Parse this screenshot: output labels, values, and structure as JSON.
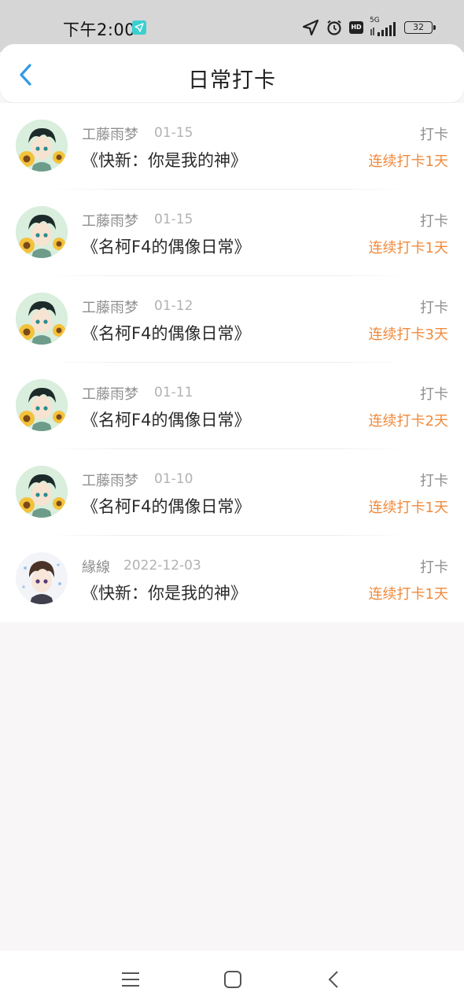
{
  "status_bar": {
    "time": "下午2:00",
    "icons": [
      "location-icon",
      "alarm-icon",
      "hd-icon",
      "5g-signal-icon"
    ],
    "hd": "HD",
    "network": "5G",
    "battery": "32"
  },
  "header": {
    "back_icon": "chevron-left-icon",
    "title": "日常打卡",
    "accent_color": "#2f9be6"
  },
  "checkins": [
    {
      "user": "工藤雨梦",
      "date": "01-15",
      "book": "《快新：你是我的神》",
      "action": "打卡",
      "streak": "连续打卡1天",
      "avatar": "sunflower-boy-avatar"
    },
    {
      "user": "工藤雨梦",
      "date": "01-15",
      "book": "《名柯F4的偶像日常》",
      "action": "打卡",
      "streak": "连续打卡1天",
      "avatar": "sunflower-boy-avatar"
    },
    {
      "user": "工藤雨梦",
      "date": "01-12",
      "book": "《名柯F4的偶像日常》",
      "action": "打卡",
      "streak": "连续打卡3天",
      "avatar": "sunflower-boy-avatar"
    },
    {
      "user": "工藤雨梦",
      "date": "01-11",
      "book": "《名柯F4的偶像日常》",
      "action": "打卡",
      "streak": "连续打卡2天",
      "avatar": "sunflower-boy-avatar"
    },
    {
      "user": "工藤雨梦",
      "date": "01-10",
      "book": "《名柯F4的偶像日常》",
      "action": "打卡",
      "streak": "连续打卡1天",
      "avatar": "sunflower-boy-avatar"
    },
    {
      "user": "緣線",
      "date": "2022-12-03",
      "book": "《快新：你是我的神》",
      "action": "打卡",
      "streak": "连续打卡1天",
      "avatar": "brown-hair-boy-avatar"
    }
  ],
  "colors": {
    "streak": "#f08a3c",
    "meta_text": "#8f8f8f",
    "date_text": "#b2b2b2",
    "background": "#f8f6f7"
  },
  "nav_bar": {
    "buttons": [
      "menu-icon",
      "home-icon",
      "back-icon"
    ]
  }
}
